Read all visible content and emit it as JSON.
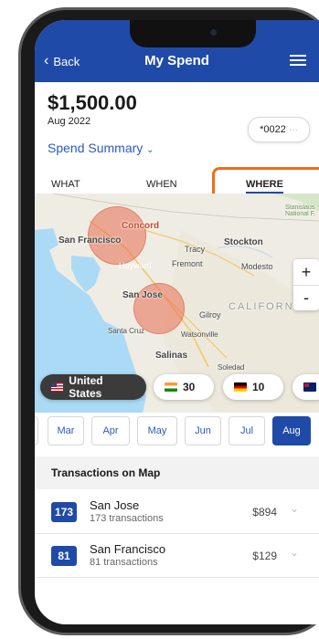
{
  "header": {
    "back_label": "Back",
    "title": "My Spend"
  },
  "summary": {
    "amount": "$1,500.00",
    "period": "Aug 2022",
    "card_label": "*0022",
    "card_more": "···",
    "spend_summary_label": "Spend Summary"
  },
  "tabs": [
    {
      "label": "WHAT",
      "active": false
    },
    {
      "label": "WHEN",
      "active": false
    },
    {
      "label": "WHERE",
      "active": true
    }
  ],
  "map": {
    "labels": {
      "concord": "Concord",
      "san_francisco": "San Francisco",
      "tracy": "Tracy",
      "stockton": "Stockton",
      "hayward": "Hayward",
      "fremont": "Fremont",
      "modesto": "Modesto",
      "san_jose": "San Jose",
      "gilroy": "Gilroy",
      "california": "CALIFORNIA",
      "santa_cruz": "Santa Cruz",
      "watsonville": "Watsonville",
      "salinas": "Salinas",
      "soledad": "Soledad",
      "stanislaus": "Stanislaus National F."
    },
    "zoom_in": "+",
    "zoom_out": "-"
  },
  "countries": [
    {
      "label": "United States",
      "selected": true
    },
    {
      "label": "30",
      "selected": false
    },
    {
      "label": "10",
      "selected": false
    }
  ],
  "months": [
    {
      "label": "Mar",
      "active": false
    },
    {
      "label": "Apr",
      "active": false
    },
    {
      "label": "May",
      "active": false
    },
    {
      "label": "Jun",
      "active": false
    },
    {
      "label": "Jul",
      "active": false
    },
    {
      "label": "Aug",
      "active": true
    }
  ],
  "transactions": {
    "section_title": "Transactions on Map",
    "rows": [
      {
        "badge": "173",
        "city": "San Jose",
        "count": "173 transactions",
        "amount": "$894"
      },
      {
        "badge": "81",
        "city": "San Francisco",
        "count": "81 transactions",
        "amount": "$129"
      }
    ]
  },
  "colors": {
    "primary": "#1f4aa8",
    "highlight": "#ef6d1a",
    "bubble": "#e86e50"
  },
  "icons": [
    "chevron-left-icon",
    "menu-icon",
    "chevron-down-icon",
    "chevron-right-icon",
    "flag-us-icon",
    "flag-in-icon",
    "flag-de-icon",
    "flag-au-icon"
  ]
}
